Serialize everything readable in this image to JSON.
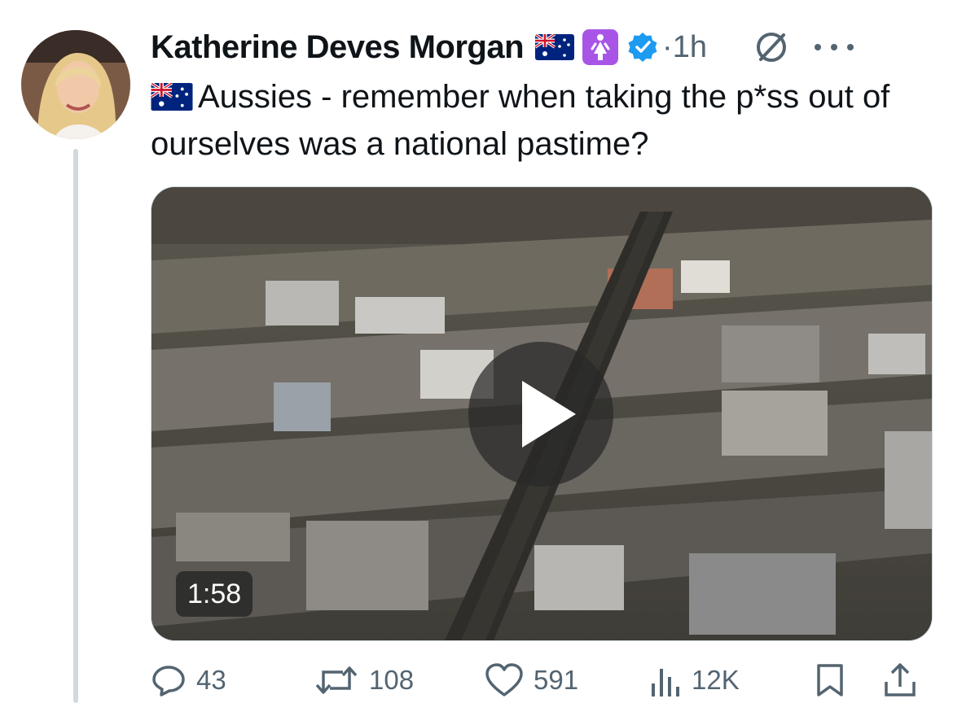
{
  "author": {
    "display_name": "Katherine Deves Morgan",
    "timestamp": "1h",
    "separator": "·",
    "verified_color": "#1d9bf0",
    "badges": [
      "australian-flag-icon",
      "woman-symbol-icon",
      "verified-badge-icon"
    ]
  },
  "tweet": {
    "text": "Aussies - remember when taking the p*ss out of ourselves was a national pastime?",
    "leading_emoji": "australian-flag-icon"
  },
  "media": {
    "type": "video",
    "duration": "1:58"
  },
  "actions": {
    "reply_count": "43",
    "retweet_count": "108",
    "like_count": "591",
    "view_count": "12K"
  },
  "colors": {
    "text_primary": "#0f1419",
    "text_secondary": "#536471",
    "thread_line": "#cfd9de",
    "accent": "#1d9bf0"
  }
}
